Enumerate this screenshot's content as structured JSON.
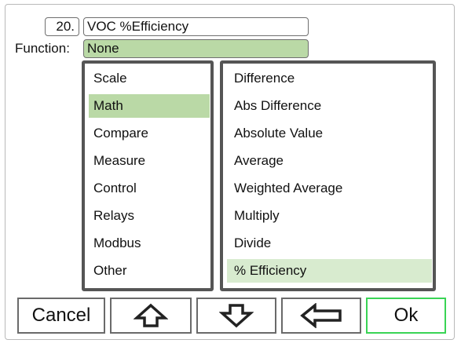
{
  "header": {
    "tag_number": "20.",
    "tag_name": "VOC %Efficiency"
  },
  "function": {
    "label": "Function:",
    "value": "None"
  },
  "categories": [
    {
      "label": "Scale",
      "selected": false
    },
    {
      "label": "Math",
      "selected": true
    },
    {
      "label": "Compare",
      "selected": false
    },
    {
      "label": "Measure",
      "selected": false
    },
    {
      "label": "Control",
      "selected": false
    },
    {
      "label": "Relays",
      "selected": false
    },
    {
      "label": "Modbus",
      "selected": false
    },
    {
      "label": "Other",
      "selected": false
    }
  ],
  "math_functions": [
    {
      "label": "Difference",
      "selected": false
    },
    {
      "label": "Abs Difference",
      "selected": false
    },
    {
      "label": "Absolute Value",
      "selected": false
    },
    {
      "label": "Average",
      "selected": false
    },
    {
      "label": "Weighted Average",
      "selected": false
    },
    {
      "label": "Multiply",
      "selected": false
    },
    {
      "label": "Divide",
      "selected": false
    },
    {
      "label": "% Efficiency",
      "selected": true
    }
  ],
  "buttons": {
    "cancel": "Cancel",
    "up_icon": "arrow-up-icon",
    "down_icon": "arrow-down-icon",
    "back_icon": "arrow-left-icon",
    "ok": "Ok"
  },
  "colors": {
    "selection": "#bad9a6",
    "ok_border": "#39d455",
    "panel_border": "#555555"
  }
}
